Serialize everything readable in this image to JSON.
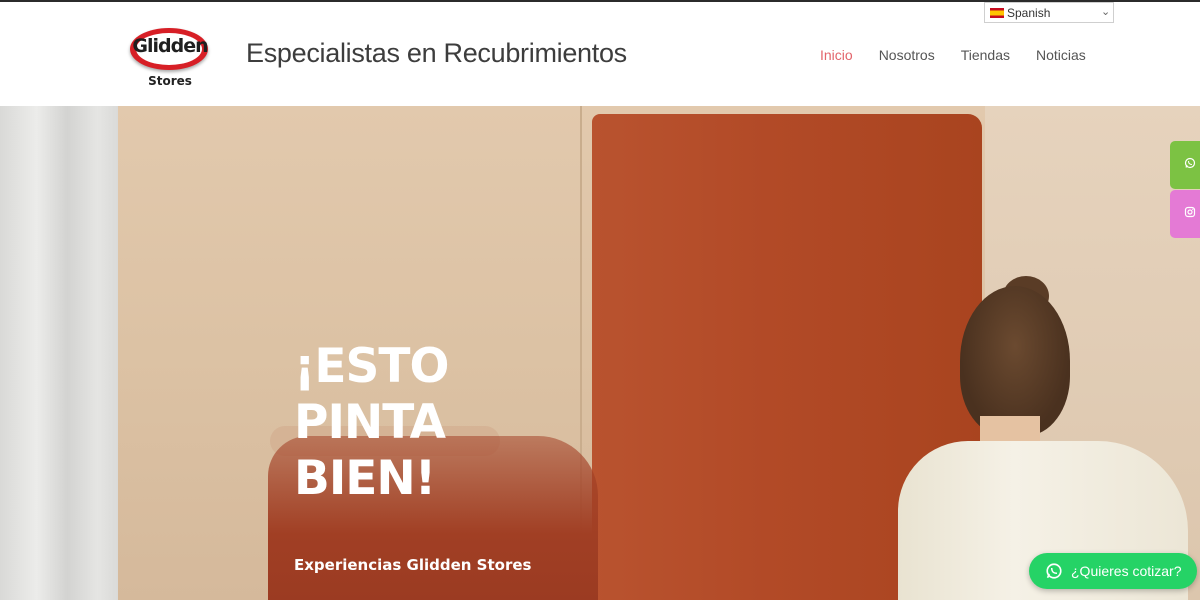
{
  "header": {
    "logo_word": "Glidden",
    "logo_sub": "Stores",
    "tagline": "Especialistas en Recubrimientos",
    "nav": [
      "Inicio",
      "Nosotros",
      "Tiendas",
      "Noticias"
    ],
    "nav_active": "Inicio",
    "language": "Spanish"
  },
  "hero": {
    "headline": [
      "¡ESTO",
      "PINTA",
      "BIEN!"
    ],
    "subline": "Experiencias Glidden Stores"
  },
  "floating": {
    "cta_label": "¿Quieres cotizar?"
  },
  "colors": {
    "nav_active": "#e3656c",
    "whatsapp_tab": "#7cc243",
    "instagram_tab": "#e47ad5",
    "cta": "#25d366",
    "paint": "#b24a27"
  },
  "icons": [
    "whatsapp-icon",
    "instagram-icon",
    "chevron-down-icon",
    "spain-flag-icon"
  ]
}
